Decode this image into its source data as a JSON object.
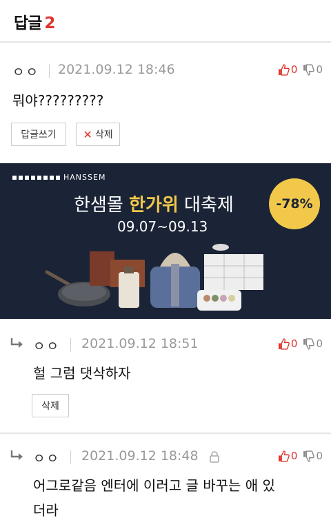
{
  "header": {
    "title": "답글",
    "count": "2"
  },
  "comments": [
    {
      "author": "ㅇㅇ",
      "date": "2021.09.12 18:46",
      "up": "0",
      "down": "0",
      "text": "뭐야?????????",
      "actions": {
        "reply": "답글쓰기",
        "delete_mark": "✕",
        "delete": "삭제"
      }
    },
    {
      "author": "ㅇㅇ",
      "date": "2021.09.12 18:51",
      "up": "0",
      "down": "0",
      "text": "헐 그럼 댓삭하자",
      "actions": {
        "delete": "삭제"
      }
    },
    {
      "author": "ㅇㅇ",
      "date": "2021.09.12 18:48",
      "up": "0",
      "down": "0",
      "text_line1": "어그로같음 엔터에 이러고 글 바꾸는 애 있",
      "text_line2": "더라"
    }
  ],
  "ad": {
    "brand": "HANSSEM",
    "title_pre": "한샘몰 ",
    "title_highlight": "한가위",
    "title_post": " 대축제",
    "dates": "09.07~09.13",
    "badge": "-78%"
  },
  "colors": {
    "accent": "#e0332b",
    "ad_bg": "#1b2436",
    "ad_gold": "#f2c84b"
  },
  "icons": {
    "upvote": "thumbs-up-icon",
    "downvote": "thumbs-down-icon",
    "reply": "reply-arrow-icon",
    "lock": "lock-icon"
  }
}
